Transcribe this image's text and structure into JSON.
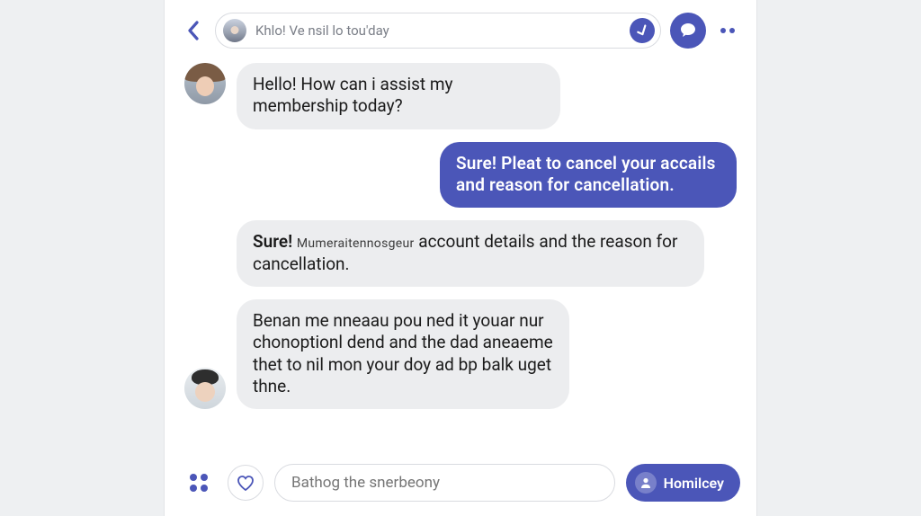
{
  "colors": {
    "accent": "#4b56b8"
  },
  "header": {
    "search_value": "Khlo! Ve nsil lo tou'day"
  },
  "messages": [
    {
      "side": "left",
      "style": "grey",
      "avatar": "agent",
      "text": "Hello! How can i assist my membership today?"
    },
    {
      "side": "right",
      "style": "accent",
      "avatar": null,
      "text": "Sure! Pleat to cancel your accails and reason for cancellation."
    },
    {
      "side": "left-indent",
      "style": "grey",
      "avatar": null,
      "rich": {
        "lead": "Sure!",
        "small": "Mumeraitennosgeur",
        "rest": " account details and the reason for cancellation."
      }
    },
    {
      "side": "left",
      "style": "grey",
      "avatar": "user",
      "text": "Benan me nneaau pou ned it youar nur chonoptionl dend and the dad aneaeme thet to nil mon your doy ad bp balk uget thne."
    }
  ],
  "composer": {
    "placeholder": "Bathog the snerbeony",
    "send_label": "Homilcey"
  }
}
